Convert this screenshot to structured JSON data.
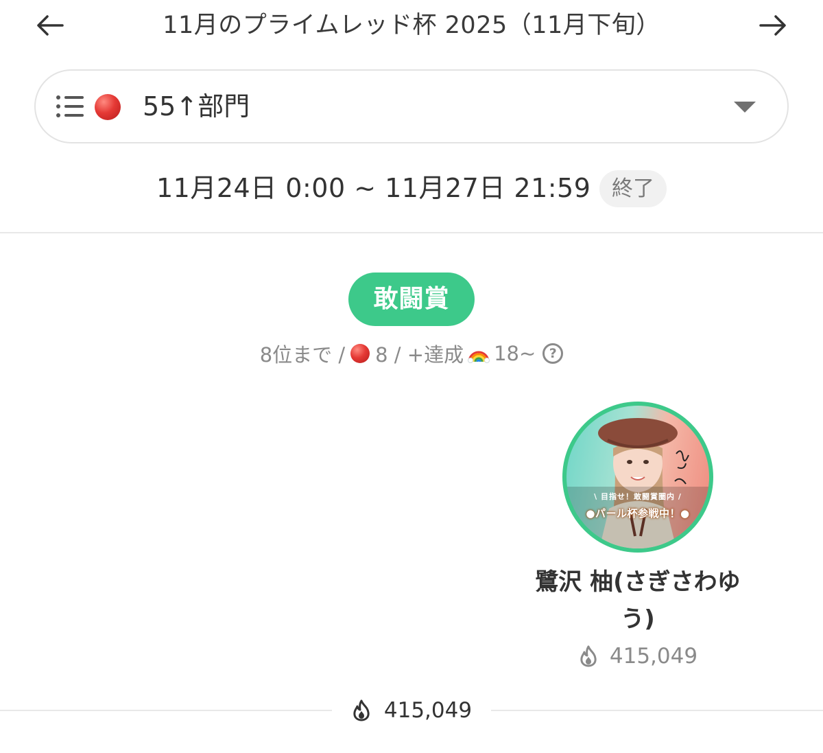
{
  "header": {
    "back_icon": "arrow-left-icon",
    "title": "11月のプライムレッド杯 2025（11月下旬）",
    "forward_icon": "arrow-right-icon"
  },
  "division_select": {
    "list_icon": "list-icon",
    "marker_icon": "red-circle-icon",
    "label": "55↑部門",
    "caret_icon": "caret-down-icon"
  },
  "period": {
    "text": "11月24日 0:00 ~ 11月27日 21:59",
    "status": "終了"
  },
  "award": {
    "name": "敢闘賞",
    "rank_condition": "8位まで /",
    "count": "8 / +達成",
    "threshold": "18~",
    "help_icon": "question-circle-icon",
    "help_glyph": "?"
  },
  "winner": {
    "name": "鷺沢 柚(さぎさわゆう)",
    "points": "415,049",
    "points_icon": "fire-icon",
    "avatar_caption_top": "\\ 目指せ！敢闘賞圏内 /",
    "avatar_caption_main": "●パール杯参戦中！●"
  },
  "total": {
    "points": "415,049",
    "points_icon": "fire-icon"
  },
  "colors": {
    "accent_green": "#3dc98a",
    "muted_text": "#8a8a8a",
    "red_marker": "#e53935"
  }
}
